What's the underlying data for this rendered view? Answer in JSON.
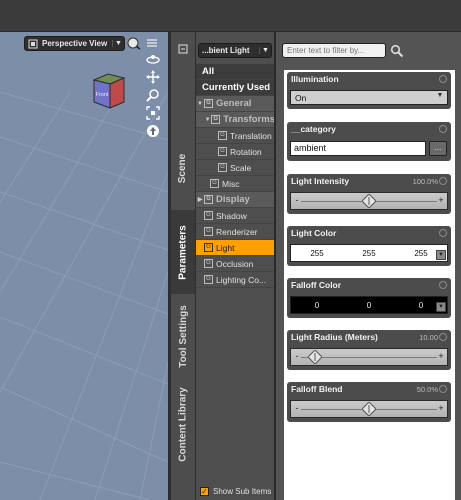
{
  "viewport": {
    "view_label": "Perspective View",
    "cube_label": "Front",
    "colors": {
      "background": "#7d8ea9",
      "grid": "#8e9cb4"
    }
  },
  "tabs": {
    "scene": "Scene",
    "parameters": "Parameters",
    "tool_settings": "Tool Settings",
    "content_library": "Content Library"
  },
  "tree": {
    "node_label": "...bient Light",
    "all": "All",
    "currently_used": "Currently Used",
    "general": "General",
    "transforms": "Transforms",
    "translation": "Translation",
    "rotation": "Rotation",
    "scale": "Scale",
    "misc": "Misc",
    "display": "Display",
    "shadow": "Shadow",
    "renderizer": "Renderizer",
    "light": "Light",
    "occlusion": "Occlusion",
    "lighting_co": "Lighting Co...",
    "show_sub_items": "Show Sub Items",
    "accent": "#ff9f00"
  },
  "props": {
    "filter_placeholder": "Enter text to filter by...",
    "illumination": {
      "label": "Illumination",
      "value": "On"
    },
    "category": {
      "label": "__category",
      "value": "ambient",
      "button": "..."
    },
    "intensity": {
      "label": "Light Intensity",
      "value_text": "100.0%",
      "level": 0.5
    },
    "color": {
      "label": "Light Color",
      "r": "255",
      "g": "255",
      "b": "255"
    },
    "falloff_color": {
      "label": "Falloff Color",
      "r": "0",
      "g": "0",
      "b": "0"
    },
    "radius": {
      "label": "Light Radius (Meters)",
      "value_text": "10.00",
      "level": 0.1
    },
    "blend": {
      "label": "Falloff Blend",
      "value_text": "50.0%",
      "level": 0.5
    }
  }
}
